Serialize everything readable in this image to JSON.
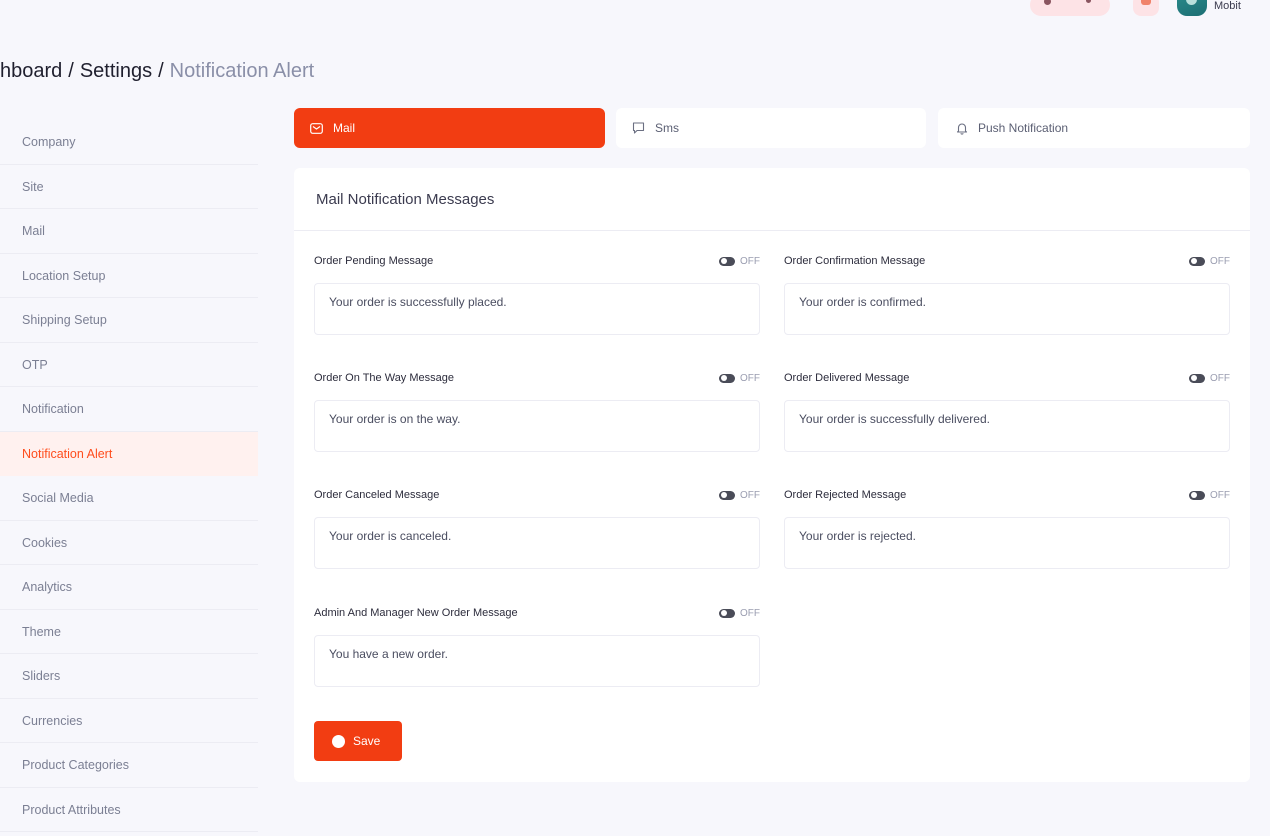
{
  "header": {
    "username": "Mobit"
  },
  "breadcrumb": {
    "part1": "hboard",
    "part2": "Settings",
    "current": "Notification Alert",
    "separator": "/"
  },
  "sidebar": {
    "items": [
      {
        "label": "Company"
      },
      {
        "label": "Site"
      },
      {
        "label": "Mail"
      },
      {
        "label": "Location Setup"
      },
      {
        "label": "Shipping Setup"
      },
      {
        "label": "OTP"
      },
      {
        "label": "Notification"
      },
      {
        "label": "Notification Alert"
      },
      {
        "label": "Social Media"
      },
      {
        "label": "Cookies"
      },
      {
        "label": "Analytics"
      },
      {
        "label": "Theme"
      },
      {
        "label": "Sliders"
      },
      {
        "label": "Currencies"
      },
      {
        "label": "Product Categories"
      },
      {
        "label": "Product Attributes"
      }
    ],
    "active_index": 7
  },
  "tabs": {
    "mail": "Mail",
    "sms": "Sms",
    "push": "Push Notification"
  },
  "card": {
    "title": "Mail Notification Messages"
  },
  "fields": [
    {
      "label": "Order Pending Message",
      "value": "Your order is successfully placed.",
      "toggle": "OFF"
    },
    {
      "label": "Order Confirmation Message",
      "value": "Your order is confirmed.",
      "toggle": "OFF"
    },
    {
      "label": "Order On The Way Message",
      "value": "Your order is on the way.",
      "toggle": "OFF"
    },
    {
      "label": "Order Delivered Message",
      "value": "Your order is successfully delivered.",
      "toggle": "OFF"
    },
    {
      "label": "Order Canceled Message",
      "value": "Your order is canceled.",
      "toggle": "OFF"
    },
    {
      "label": "Order Rejected Message",
      "value": "Your order is rejected.",
      "toggle": "OFF"
    },
    {
      "label": "Admin And Manager New Order Message",
      "value": "You have a new order.",
      "toggle": "OFF"
    }
  ],
  "save_label": "Save",
  "colors": {
    "accent": "#f23d12",
    "active_bg": "#fff1ef",
    "muted_text": "#8a8fa8"
  },
  "icons": {
    "mail": "mail-icon",
    "sms": "sms-icon",
    "push": "bell-icon",
    "save": "save-icon"
  }
}
